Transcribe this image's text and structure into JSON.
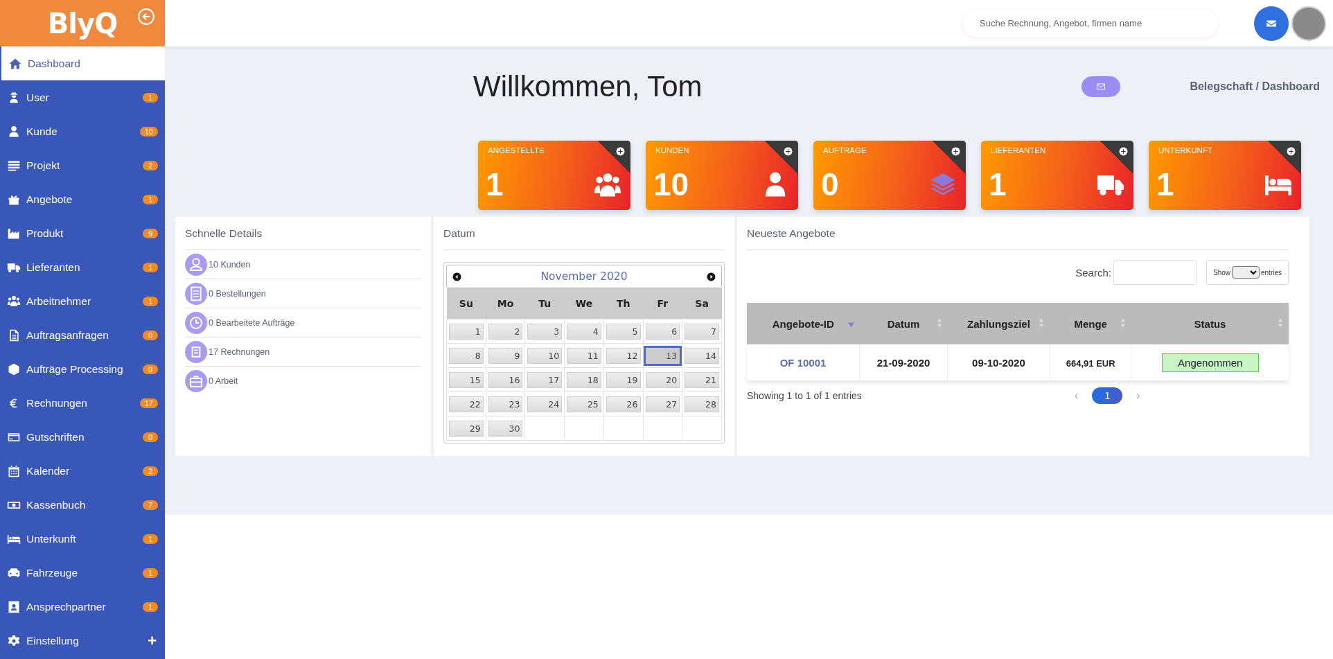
{
  "header": {
    "logo": "BlyQ",
    "search": {
      "placeholder": "Suche Rechnung, Angebot, firmen name"
    }
  },
  "sidebar": {
    "items": [
      {
        "label": "Dashboard",
        "selected": true
      },
      {
        "label": "User",
        "badge": "1",
        "selected": false
      },
      {
        "label": "Kunde",
        "badge": "10",
        "selected": false
      },
      {
        "label": "Projekt",
        "badge": "2",
        "selected": false
      },
      {
        "label": "Angebote",
        "badge": "1",
        "selected": false
      },
      {
        "label": "Produkt",
        "badge": "9",
        "selected": false
      },
      {
        "label": "Lieferanten",
        "badge": "1",
        "selected": false
      },
      {
        "label": "Arbeitnehmer",
        "badge": "1",
        "selected": false
      },
      {
        "label": "Auftragsanfragen",
        "badge": "0",
        "selected": false
      },
      {
        "label": "Aufträge Processing",
        "badge": "0",
        "selected": false
      },
      {
        "label": "Rechnungen",
        "badge": "17",
        "selected": false
      },
      {
        "label": "Gutschriften",
        "badge": "0",
        "selected": false
      },
      {
        "label": "Kalender",
        "badge": "2",
        "selected": false
      },
      {
        "label": "Kassenbuch",
        "badge": "7",
        "selected": false
      },
      {
        "label": "Unterkunft",
        "badge": "1",
        "selected": false
      },
      {
        "label": "Fahrzeuge",
        "badge": "1",
        "selected": false
      },
      {
        "label": "Ansprechpartner",
        "badge": "1",
        "selected": false
      },
      {
        "label": "Einstellung",
        "expander": "+",
        "selected": false
      }
    ]
  },
  "page": {
    "title": "Willkommen, Tom",
    "breadcrumb": "Belegschaft / Dashboard"
  },
  "stats": [
    {
      "label": "ANGESTELLTE",
      "value": "1"
    },
    {
      "label": "KUNDEN",
      "value": "10"
    },
    {
      "label": "AUFTRÄGE",
      "value": "0"
    },
    {
      "label": "LIEFERANTEN",
      "value": "1"
    },
    {
      "label": "UNTERKUNFT",
      "value": "1"
    }
  ],
  "quick_details": {
    "title": "Schnelle Details",
    "items": [
      "10 Kunden",
      "0 Bestellungen",
      "0 Bearbeitete Aufträge",
      "17 Rechnungen",
      "0 Arbeit"
    ]
  },
  "calendar": {
    "title": "Datum",
    "month": "November 2020",
    "weekdays": [
      "Su",
      "Mo",
      "Tu",
      "We",
      "Th",
      "Fr",
      "Sa"
    ],
    "days": [
      {
        "label": "1",
        "selected": false
      },
      {
        "label": "2",
        "selected": false
      },
      {
        "label": "3",
        "selected": false
      },
      {
        "label": "4",
        "selected": false
      },
      {
        "label": "5",
        "selected": false
      },
      {
        "label": "6",
        "selected": false
      },
      {
        "label": "7",
        "selected": false
      },
      {
        "label": "8",
        "selected": false
      },
      {
        "label": "9",
        "selected": false
      },
      {
        "label": "10",
        "selected": false
      },
      {
        "label": "11",
        "selected": false
      },
      {
        "label": "12",
        "selected": false
      },
      {
        "label": "13",
        "selected": true
      },
      {
        "label": "14",
        "selected": false
      },
      {
        "label": "15",
        "selected": false
      },
      {
        "label": "16",
        "selected": false
      },
      {
        "label": "17",
        "selected": false
      },
      {
        "label": "18",
        "selected": false
      },
      {
        "label": "19",
        "selected": false
      },
      {
        "label": "20",
        "selected": false
      },
      {
        "label": "21",
        "selected": false
      },
      {
        "label": "22",
        "selected": false
      },
      {
        "label": "23",
        "selected": false
      },
      {
        "label": "24",
        "selected": false
      },
      {
        "label": "25",
        "selected": false
      },
      {
        "label": "26",
        "selected": false
      },
      {
        "label": "27",
        "selected": false
      },
      {
        "label": "28",
        "selected": false
      },
      {
        "label": "29",
        "selected": false
      },
      {
        "label": "30",
        "selected": false
      }
    ]
  },
  "offers": {
    "title": "Neueste Angebote",
    "search_label": "Search:",
    "show_label": "Show",
    "entries_label": "entries",
    "table": {
      "columns": [
        {
          "label": "Angebote-ID",
          "sorted": true
        },
        {
          "label": "Datum",
          "sorted": false
        },
        {
          "label": "Zahlungsziel",
          "sorted": false
        },
        {
          "label": "Menge",
          "sorted": false
        },
        {
          "label": "Status",
          "sorted": false
        }
      ],
      "rows": [
        {
          "cells": [
            {
              "kind": "link",
              "text": "OF 10001"
            },
            {
              "kind": "text",
              "text": "21-09-2020"
            },
            {
              "kind": "text",
              "text": "09-10-2020"
            },
            {
              "kind": "amount",
              "text": "664,91 EUR"
            },
            {
              "kind": "status",
              "text": "Angenommen"
            }
          ]
        }
      ]
    },
    "info": "Showing 1 to 1 of 1 entries",
    "pagination": {
      "prev": "‹",
      "pages": [
        {
          "label": "1",
          "selected": true
        }
      ],
      "next": "›"
    }
  }
}
